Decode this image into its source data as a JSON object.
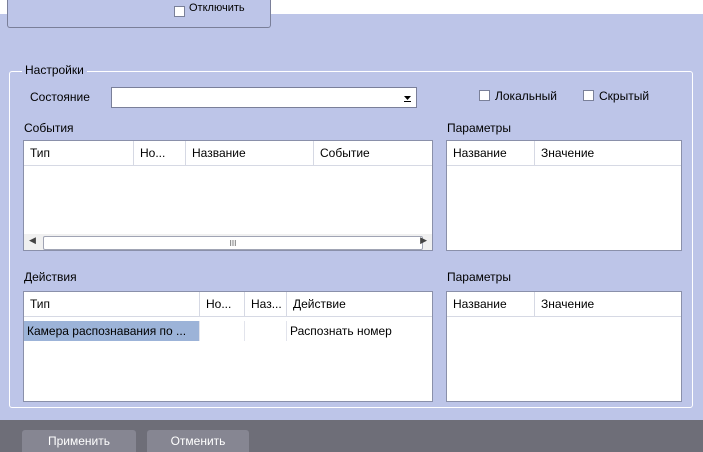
{
  "top": {
    "disable_label": "Отключить"
  },
  "settings": {
    "group_label": "Настройки",
    "state_label": "Состояние",
    "state_value": "",
    "local_label": "Локальный",
    "hidden_label": "Скрытый"
  },
  "events": {
    "label": "События",
    "columns": [
      "Тип",
      "Но...",
      "Название",
      "Событие"
    ],
    "scroll_grip": "III"
  },
  "event_params": {
    "label": "Параметры",
    "columns": [
      "Название",
      "Значение"
    ]
  },
  "actions": {
    "label": "Действия",
    "columns": [
      "Тип",
      "Но...",
      "Наз...",
      "Действие"
    ],
    "rows": [
      [
        "Камера распознавания по ...",
        "",
        "",
        "Распознать номер"
      ]
    ]
  },
  "action_params": {
    "label": "Параметры",
    "columns": [
      "Название",
      "Значение"
    ]
  },
  "buttons": {
    "apply": "Применить",
    "cancel": "Отменить"
  },
  "colors": {
    "background": "#bdc5e8",
    "selection": "#9cb3d8",
    "bottom_bar": "#6e6e78"
  }
}
